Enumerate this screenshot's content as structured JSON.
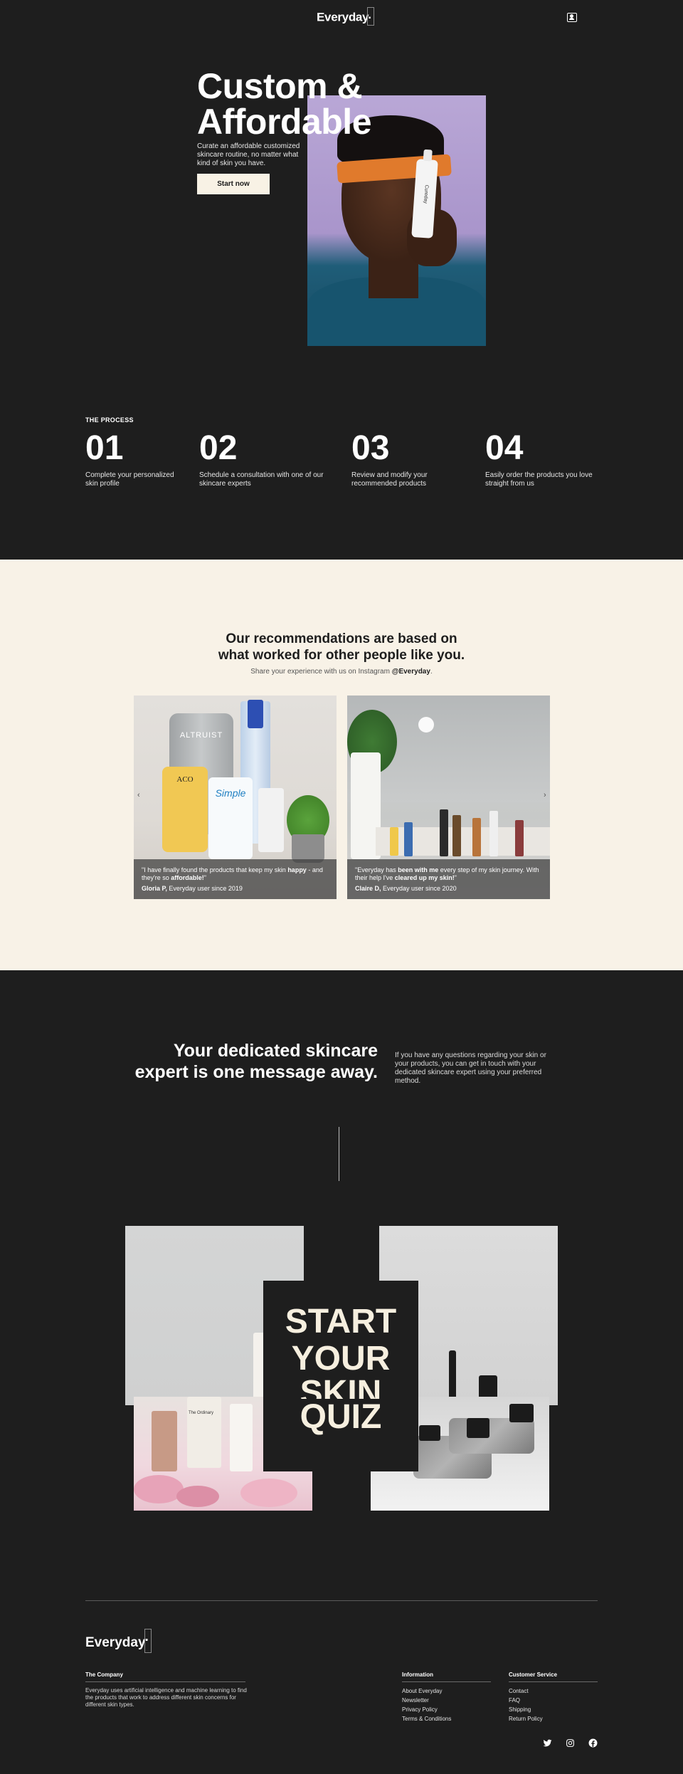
{
  "header": {
    "logo": "Everyday"
  },
  "hero": {
    "title_line1": "Custom &",
    "title_line2": "Affordable",
    "subtitle": "Curate an affordable customized skincare routine, no matter what kind of skin you have.",
    "cta": "Start now",
    "bottle_label": "Cureday"
  },
  "process": {
    "label": "THE PROCESS",
    "steps": [
      {
        "num": "01",
        "desc": "Complete your personalized skin profile"
      },
      {
        "num": "02",
        "desc": "Schedule a consultation with one of our skincare experts"
      },
      {
        "num": "03",
        "desc": "Review and modify your recommended products"
      },
      {
        "num": "04",
        "desc": "Easily order the products you love straight from us"
      }
    ]
  },
  "reviews": {
    "title_line1": "Our recommendations are based on",
    "title_line2": "what worked for other people like you.",
    "subtitle_prefix": "Share your experience with us on Instagram ",
    "subtitle_handle": "@Everyday",
    "subtitle_suffix": ".",
    "cards": [
      {
        "quote_pre": "\"I have finally found the products that keep my skin ",
        "quote_b1": "happy",
        "quote_mid": " - and they're so ",
        "quote_b2": "affordable!",
        "quote_post": "\"",
        "author_name": "Gloria P,",
        "author_since": " Everyday user since 2019",
        "product_labels": [
          "ALTRUIST",
          "ACO",
          "Simple"
        ]
      },
      {
        "quote_pre": "\"Everyday has ",
        "quote_b1": "been with me",
        "quote_mid": " every step of my skin journey. With their help I've ",
        "quote_b2": "cleared up my skin!",
        "quote_post": "\"",
        "author_name": "Claire D,",
        "author_since": " Everyday user since 2020"
      }
    ],
    "prev_arrow": "‹",
    "next_arrow": "›"
  },
  "expert": {
    "title_line1": "Your dedicated skincare",
    "title_line2": "expert is one message away.",
    "subtitle": "If you have any questions regarding your skin or your products, you can get in touch with your dedicated skincare expert using your preferred method."
  },
  "quiz": {
    "line1": "START",
    "line2": "YOUR",
    "line3": "SKIN",
    "line4": "QUIZ",
    "bottle_label": "The Ordinary"
  },
  "footer": {
    "logo": "Everyday",
    "company": {
      "title": "The Company",
      "text": "Everyday uses artificial intelligence and machine learning to find the products that work to address different skin concerns for different skin types."
    },
    "information": {
      "title": "Information",
      "links": [
        "About Everyday",
        "Newsletter",
        "Privacy Policy",
        "Terms & Conditions"
      ]
    },
    "service": {
      "title": "Customer Service",
      "links": [
        "Contact",
        "FAQ",
        "Shipping",
        "Return Policy"
      ]
    },
    "social": [
      "twitter-icon",
      "instagram-icon",
      "facebook-icon"
    ]
  }
}
